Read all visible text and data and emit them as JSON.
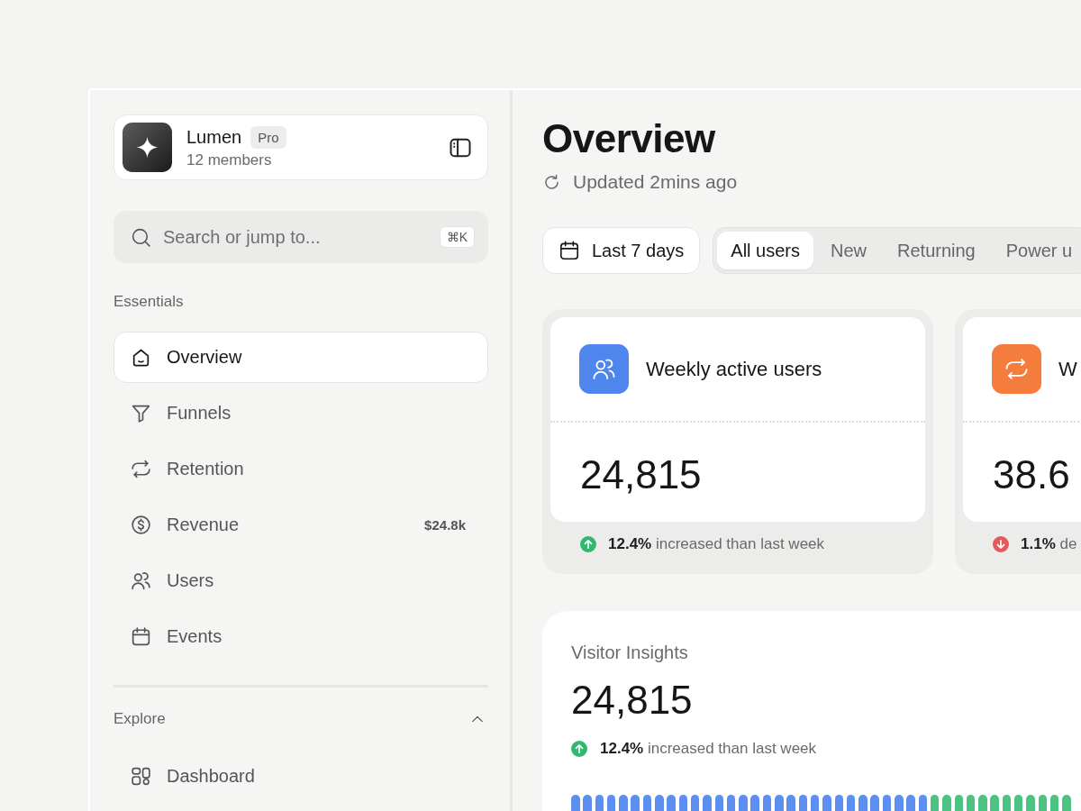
{
  "workspace": {
    "name": "Lumen",
    "plan": "Pro",
    "members": "12 members"
  },
  "search": {
    "placeholder": "Search or jump to...",
    "shortcut": "⌘K"
  },
  "sections": [
    {
      "label": "Essentials",
      "items": [
        {
          "label": "Overview",
          "selected": true
        },
        {
          "label": "Funnels",
          "selected": false
        },
        {
          "label": "Retention",
          "selected": false
        },
        {
          "label": "Revenue",
          "selected": false,
          "badge": "$24.8k"
        },
        {
          "label": "Users",
          "selected": false
        },
        {
          "label": "Events",
          "selected": false
        }
      ]
    },
    {
      "label": "Explore",
      "expanded": true,
      "items": [
        {
          "label": "Dashboard",
          "selected": false
        }
      ]
    }
  ],
  "page": {
    "title": "Overview",
    "updated": "Updated 2mins ago"
  },
  "date_range": "Last 7 days",
  "segments": [
    {
      "label": "All users",
      "selected": true
    },
    {
      "label": "New",
      "selected": false
    },
    {
      "label": "Returning",
      "selected": false
    },
    {
      "label": "Power u",
      "selected": false
    }
  ],
  "metrics": [
    {
      "title": "Weekly active users",
      "value": "24,815",
      "delta": "**12.4%** increased than last week",
      "rising": true,
      "color": "#4f86ee"
    },
    {
      "title": "W",
      "value": "38.6",
      "delta": "**1.1%** de",
      "rising": false,
      "color": "#f47c3c"
    }
  ],
  "insights": {
    "title": "Visitor Insights",
    "value": "24,815",
    "delta": "**12.4%** increased than last week",
    "rising": true
  }
}
